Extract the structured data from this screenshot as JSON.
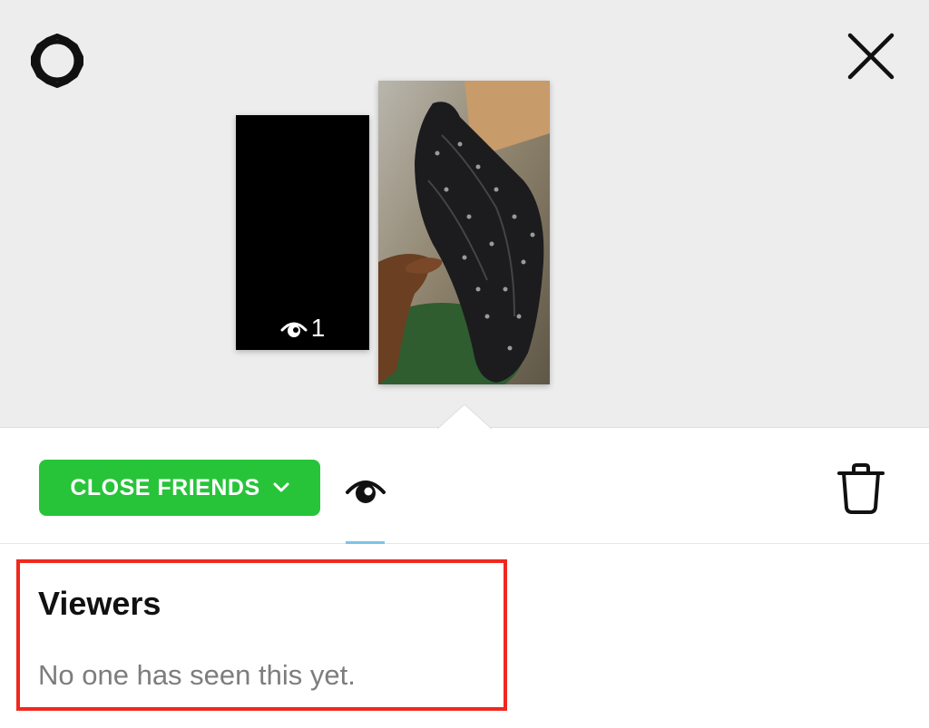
{
  "preview": {
    "settings_icon": "gear-icon",
    "close_icon": "close-icon",
    "stories": [
      {
        "type": "dark",
        "view_icon": "eye-icon",
        "view_count": "1"
      },
      {
        "type": "photo",
        "content": "black sneaker held in hand"
      }
    ]
  },
  "toolbar": {
    "audience_label": "CLOSE FRIENDS",
    "audience_icon": "chevron-down-icon",
    "audience_color": "#27c43a",
    "viewers_tab_icon": "eye-icon",
    "delete_icon": "trash-icon"
  },
  "viewers": {
    "title": "Viewers",
    "empty_message": "No one has seen this yet."
  },
  "colors": {
    "preview_bg": "#ededed",
    "highlight_border": "#f0281e"
  }
}
